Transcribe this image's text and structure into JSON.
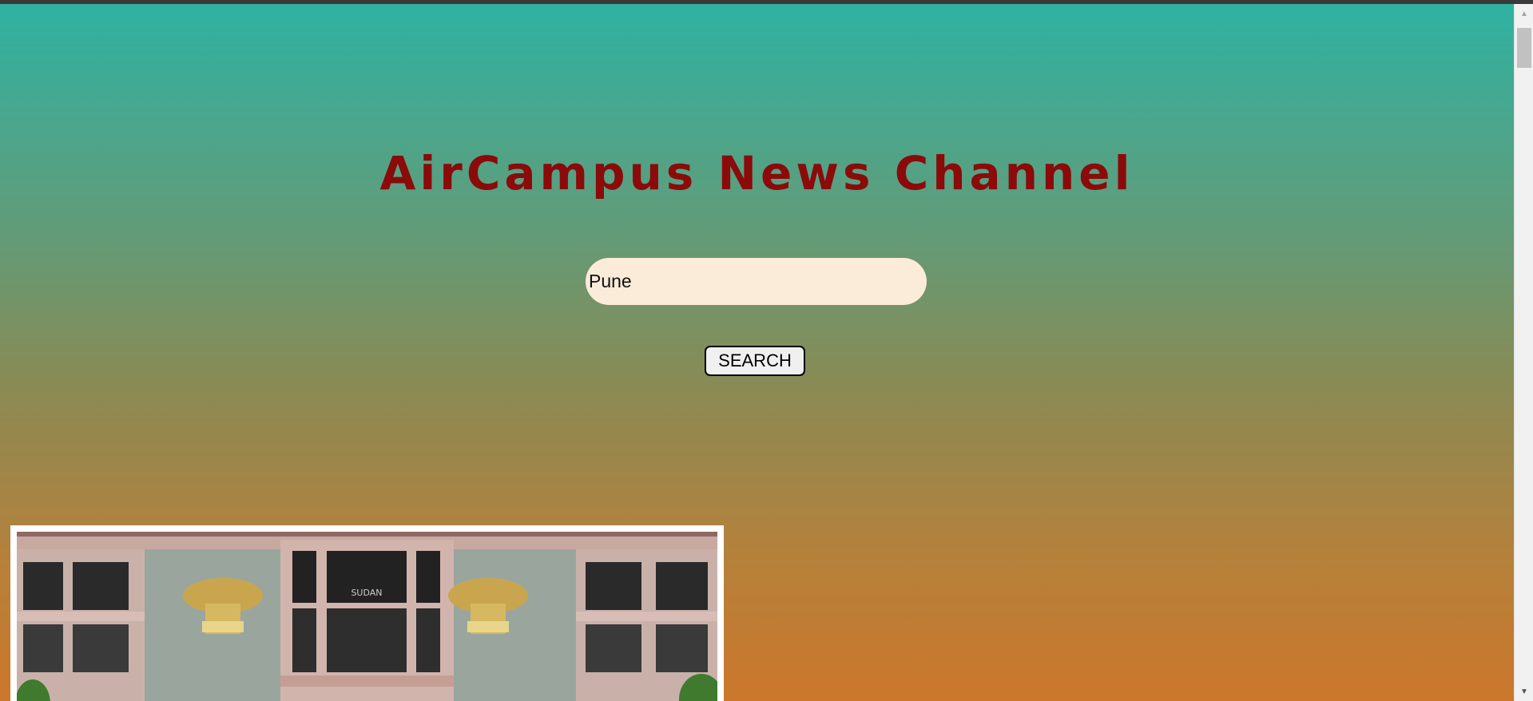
{
  "header": {
    "title": "AirCampus News Channel"
  },
  "search": {
    "value": "Pune",
    "button_label": "SEARCH"
  },
  "news": {
    "image_icon": "building-photo",
    "building_sign": "SUDAN"
  },
  "scrollbar": {
    "up_icon": "▲",
    "down_icon": "▼"
  },
  "colors": {
    "title": "#8b0a0a",
    "gradient_top": "#2fb2a2",
    "gradient_bottom": "#cc772c",
    "input_bg": "#fbebd9"
  }
}
